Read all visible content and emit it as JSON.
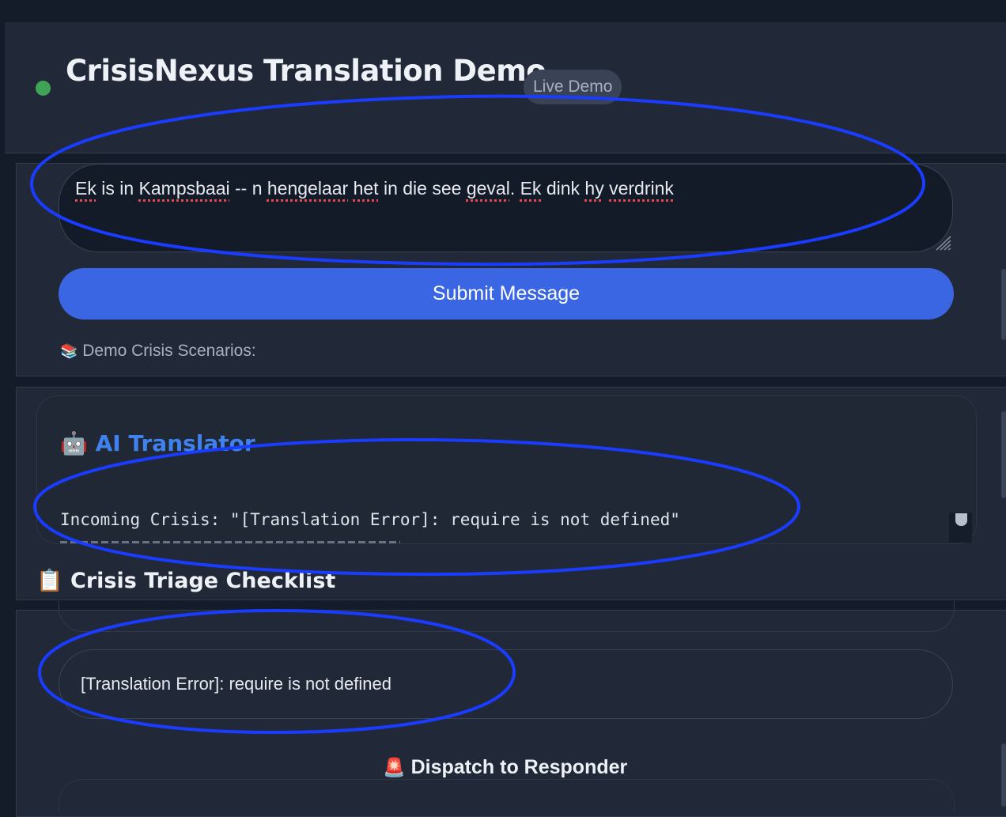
{
  "header": {
    "title": "CrisisNexus Translation Demo",
    "badge": "Live Demo",
    "status_color": "#3fa455"
  },
  "input": {
    "words": [
      "Ek",
      " is in ",
      "Kampsbaai",
      " -- n ",
      "hengelaar",
      " ",
      "het",
      " in die see ",
      "geval",
      ". ",
      "Ek",
      " dink ",
      "hy",
      " ",
      "verdrink"
    ],
    "spellcheck_flagged": [
      0,
      2,
      4,
      6,
      8,
      10,
      12,
      14
    ],
    "submit_label": "Submit Message",
    "scenarios_icon": "📚",
    "scenarios_label": "Demo Crisis Scenarios:"
  },
  "translator": {
    "icon": "🤖",
    "title": "AI Translator",
    "incoming_text": "Incoming Crisis: \"[Translation Error]: require is not defined\""
  },
  "checklist": {
    "icon": "📋",
    "title": "Crisis Triage Checklist"
  },
  "dispatch": {
    "error_text": "[Translation Error]: require is not defined",
    "button_icon": "🚨",
    "button_label": "Dispatch to Responder"
  },
  "colors": {
    "accent_blue": "#3a66e3",
    "translator_title": "#3f82ee",
    "annotation": "#1a3cff"
  }
}
